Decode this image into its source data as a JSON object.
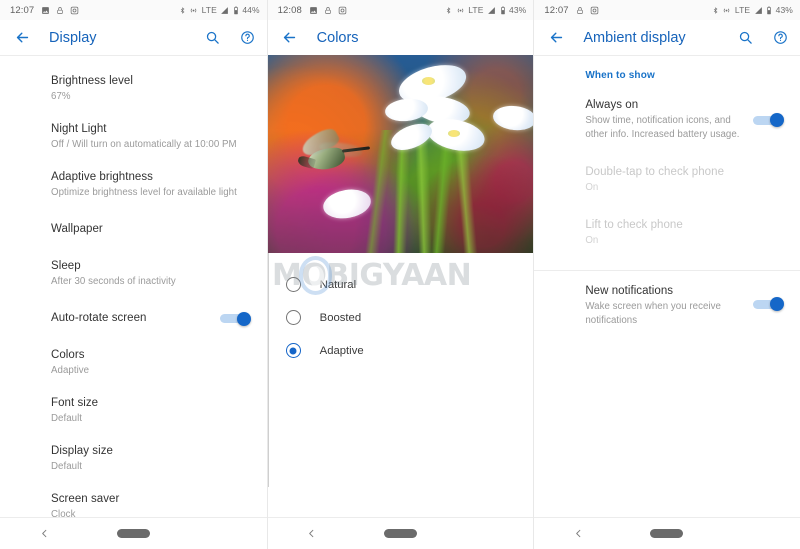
{
  "watermark": {
    "text": "MOBIGYAAN"
  },
  "colors": {
    "accent": "#1a73c8",
    "title": "#1663ba",
    "toggle_on_thumb": "#1567c8",
    "toggle_on_track": "#bcd6f2",
    "primary_text": "#333333",
    "secondary_text": "#9a9a9a",
    "disabled_text": "#c8c8c8"
  },
  "screens": [
    {
      "status": {
        "time": "12:07",
        "left_icons": [
          "screenshot-icon",
          "lock-icon",
          "camera-icon"
        ],
        "right_icons": [
          "bluetooth-icon",
          "hotspot-icon",
          "signal-icon",
          "battery-icon"
        ],
        "network": "LTE",
        "battery": "44%"
      },
      "appbar": {
        "title": "Display",
        "back": "back-arrow-icon",
        "actions": [
          "search-icon",
          "help-icon"
        ]
      },
      "rows": [
        {
          "title": "Brightness level",
          "subtitle": "67%",
          "toggle": null,
          "disabled": false
        },
        {
          "title": "Night Light",
          "subtitle": "Off / Will turn on automatically at 10:00 PM",
          "toggle": null,
          "disabled": false
        },
        {
          "title": "Adaptive brightness",
          "subtitle": "Optimize brightness level for available light",
          "toggle": null,
          "disabled": false
        },
        {
          "title": "Wallpaper",
          "subtitle": "",
          "toggle": null,
          "disabled": false
        },
        {
          "title": "Sleep",
          "subtitle": "After 30 seconds of inactivity",
          "toggle": null,
          "disabled": false
        },
        {
          "title": "Auto-rotate screen",
          "subtitle": "",
          "toggle": "on",
          "disabled": false
        },
        {
          "title": "Colors",
          "subtitle": "Adaptive",
          "toggle": null,
          "disabled": false
        },
        {
          "title": "Font size",
          "subtitle": "Default",
          "toggle": null,
          "disabled": false
        },
        {
          "title": "Display size",
          "subtitle": "Default",
          "toggle": null,
          "disabled": false
        },
        {
          "title": "Screen saver",
          "subtitle": "Clock",
          "toggle": null,
          "disabled": false
        }
      ],
      "nav": {
        "back": "nav-back-icon",
        "home": "nav-home-pill"
      }
    },
    {
      "status": {
        "time": "12:08",
        "left_icons": [
          "screenshot-icon",
          "lock-icon",
          "camera-icon"
        ],
        "right_icons": [
          "bluetooth-icon",
          "hotspot-icon",
          "signal-icon",
          "battery-icon"
        ],
        "network": "LTE",
        "battery": "43%"
      },
      "appbar": {
        "title": "Colors",
        "back": "back-arrow-icon",
        "actions": []
      },
      "preview_alt": "hummingbird-and-cosmos-flowers-preview",
      "options": [
        {
          "label": "Natural",
          "selected": false
        },
        {
          "label": "Boosted",
          "selected": false
        },
        {
          "label": "Adaptive",
          "selected": true
        }
      ],
      "nav": {
        "back": "nav-back-icon",
        "home": "nav-home-pill"
      }
    },
    {
      "status": {
        "time": "12:07",
        "left_icons": [
          "lock-icon",
          "camera-icon"
        ],
        "right_icons": [
          "bluetooth-icon",
          "hotspot-icon",
          "signal-icon",
          "battery-icon"
        ],
        "network": "LTE",
        "battery": "43%"
      },
      "appbar": {
        "title": "Ambient display",
        "back": "back-arrow-icon",
        "actions": [
          "search-icon",
          "help-icon"
        ]
      },
      "section_header": "When to show",
      "rows": [
        {
          "title": "Always on",
          "subtitle": "Show time, notification icons, and other info. Increased battery usage.",
          "toggle": "on",
          "disabled": false
        },
        {
          "title": "Double-tap to check phone",
          "subtitle": "On",
          "toggle": null,
          "disabled": true
        },
        {
          "title": "Lift to check phone",
          "subtitle": "On",
          "toggle": null,
          "disabled": true
        }
      ],
      "rows2": [
        {
          "title": "New notifications",
          "subtitle": "Wake screen when you receive notifications",
          "toggle": "on",
          "disabled": false
        }
      ],
      "nav": {
        "back": "nav-back-icon",
        "home": "nav-home-pill"
      }
    }
  ]
}
